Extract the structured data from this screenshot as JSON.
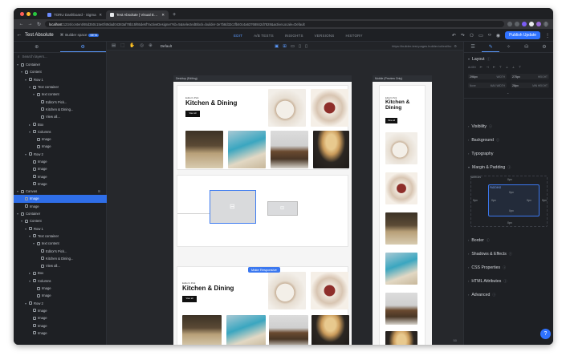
{
  "browser": {
    "tabs": [
      {
        "title": "TORU Dashboard - Sigma",
        "active": false
      },
      {
        "title": "Test Absolute | Visual Editor | ...",
        "active": true
      }
    ],
    "new_tab": "+",
    "url_host": "localhost",
    "url_rest": ":1234/content/65d350c15e0f49dad04383af78b15f65de6f?activeDesigner?sb=5&selectedBlock=builder-2e7b8d32c2fb40c4a63768842d7828&activeLocale=Default"
  },
  "app": {
    "project_title": "Test Absolute",
    "space_label": "Builder space",
    "space_badge": "BETA",
    "main_tabs": [
      "EDIT",
      "A/B TESTS",
      "INSIGHTS",
      "VERSIONS",
      "HISTORY"
    ],
    "active_tab": "EDIT",
    "publish_label": "Publish Update"
  },
  "left_panel": {
    "search_placeholder": "Search layers...",
    "layers": [
      {
        "label": "Container",
        "depth": 0,
        "caret": "▾"
      },
      {
        "label": "Content",
        "depth": 1,
        "caret": "▾"
      },
      {
        "label": "Row 1",
        "depth": 2,
        "caret": "▾"
      },
      {
        "label": "Text container",
        "depth": 3,
        "caret": "▾"
      },
      {
        "label": "text content",
        "depth": 4,
        "caret": "▾"
      },
      {
        "label": "Editor's Pick...",
        "depth": 5,
        "caret": ""
      },
      {
        "label": "Kitchen & Dining...",
        "depth": 5,
        "caret": ""
      },
      {
        "label": "View all...",
        "depth": 5,
        "caret": ""
      },
      {
        "label": "Box",
        "depth": 3,
        "caret": "▸"
      },
      {
        "label": "Columns",
        "depth": 3,
        "caret": "▾"
      },
      {
        "label": "Image",
        "depth": 4,
        "caret": ""
      },
      {
        "label": "Image",
        "depth": 4,
        "caret": ""
      },
      {
        "label": "Row 2",
        "depth": 2,
        "caret": "▾"
      },
      {
        "label": "Image",
        "depth": 3,
        "caret": ""
      },
      {
        "label": "Image",
        "depth": 3,
        "caret": ""
      },
      {
        "label": "Image",
        "depth": 3,
        "caret": ""
      },
      {
        "label": "Image",
        "depth": 3,
        "caret": ""
      },
      {
        "label": "Canvas",
        "depth": 0,
        "caret": "▾",
        "right": "⊞"
      },
      {
        "label": "Image",
        "depth": 1,
        "caret": "",
        "selected": true
      },
      {
        "label": "Image",
        "depth": 1,
        "caret": ""
      },
      {
        "label": "Container",
        "depth": 0,
        "caret": "▾"
      },
      {
        "label": "Content",
        "depth": 1,
        "caret": "▾"
      },
      {
        "label": "Row 1",
        "depth": 2,
        "caret": "▾"
      },
      {
        "label": "Text container",
        "depth": 3,
        "caret": "▾"
      },
      {
        "label": "text content",
        "depth": 4,
        "caret": "▾"
      },
      {
        "label": "Editor's Pick...",
        "depth": 5,
        "caret": ""
      },
      {
        "label": "Kitchen & Dining...",
        "depth": 5,
        "caret": ""
      },
      {
        "label": "View all...",
        "depth": 5,
        "caret": ""
      },
      {
        "label": "Box",
        "depth": 3,
        "caret": "▸"
      },
      {
        "label": "Columns",
        "depth": 3,
        "caret": "▾"
      },
      {
        "label": "Image",
        "depth": 4,
        "caret": ""
      },
      {
        "label": "Image",
        "depth": 4,
        "caret": ""
      },
      {
        "label": "Row 2",
        "depth": 2,
        "caret": "▾"
      },
      {
        "label": "Image",
        "depth": 3,
        "caret": ""
      },
      {
        "label": "Image",
        "depth": 3,
        "caret": ""
      },
      {
        "label": "Image",
        "depth": 3,
        "caret": ""
      },
      {
        "label": "Image",
        "depth": 3,
        "caret": ""
      }
    ]
  },
  "canvas": {
    "breakpoint_label": "Default",
    "preview_url": "https://builder-test-pages.builder.io/test/ho",
    "desktop_frame_label": "Desktop (Editing)",
    "mobile_frame_label": "Mobile (Preview Only)",
    "card_eyebrow": "Editor's Pick",
    "card_title": "Kitchen & Dining",
    "card_button": "View all",
    "make_responsive": "Make Responsive",
    "zoom": "50"
  },
  "right_panel": {
    "layout": {
      "title": "Layout",
      "align_label": "ALIGN",
      "width_value": "296px",
      "width_label": "WIDTH",
      "height_value": "275px",
      "height_label": "HEIGHT",
      "maxw_label": "MAX WIDTH",
      "minh_label": "MIN HEIGHT",
      "min_label": "None",
      "maxw_value": "",
      "minh_value": "28px"
    },
    "sections": [
      "Visibility",
      "Background",
      "Typography",
      "Margin & Padding",
      "Border",
      "Shadows & Effects",
      "CSS Properties",
      "HTML Attributes",
      "Advanced"
    ],
    "margin_label": "MARGIN",
    "padding_label": "PADDING",
    "spacing_value": "0px"
  },
  "colors": {
    "accent": "#2f72ff",
    "selection": "#2f6ee8",
    "panel": "#1e2024",
    "canvas": "#26282c"
  }
}
